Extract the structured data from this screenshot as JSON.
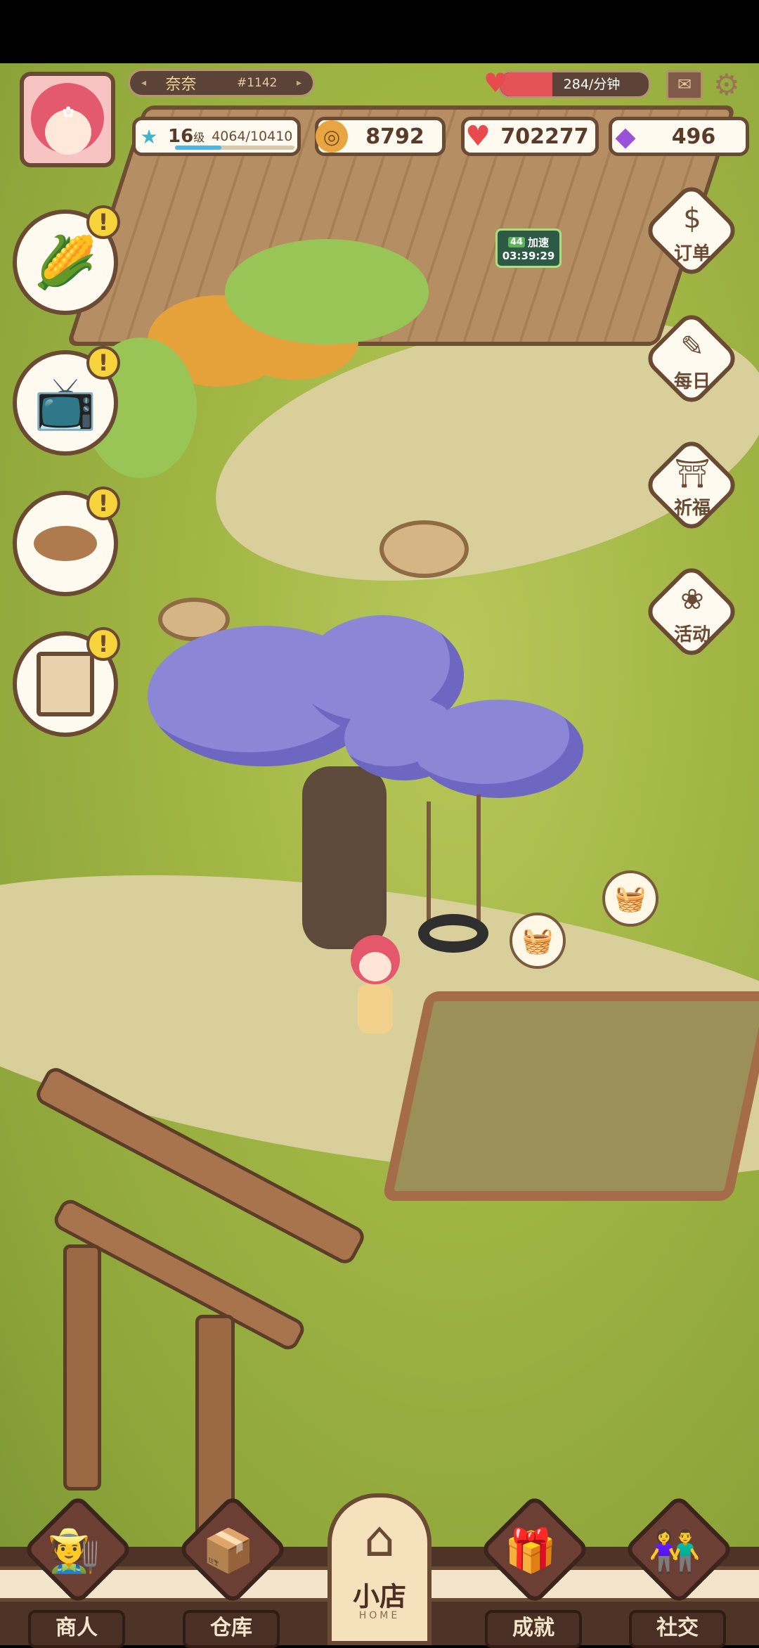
{
  "player": {
    "name": "奈奈",
    "id": "#1142",
    "level": "16",
    "level_unit": "级",
    "xp": "4064/10410",
    "xp_fraction": 0.39
  },
  "production": {
    "rate": "284/分钟"
  },
  "resources": {
    "coins": "8792",
    "hearts": "702277",
    "gems": "496"
  },
  "shop_timer": {
    "level": "44",
    "label": "加速",
    "time": "03:39:29"
  },
  "left_quests": [
    {
      "icon": "corn-icon",
      "alert": "!"
    },
    {
      "icon": "tv-ad-icon",
      "alert": "!"
    },
    {
      "icon": "flour-icon",
      "alert": "!"
    },
    {
      "icon": "shop-sign-icon",
      "alert": "!"
    }
  ],
  "right_menu": [
    {
      "label": "订单",
      "icon": "order-book-icon"
    },
    {
      "label": "每日",
      "icon": "daily-notepad-icon"
    },
    {
      "label": "祈福",
      "icon": "prayer-icon"
    },
    {
      "label": "活动",
      "icon": "event-balloon-icon"
    }
  ],
  "bottom_nav": {
    "merchant": "商人",
    "warehouse": "仓库",
    "home": "小店",
    "home_sub": "HOME",
    "achievement": "成就",
    "social": "社交"
  },
  "colors": {
    "frame_brown": "#6b4a34",
    "cream": "#fffaf0",
    "heart_red": "#e74b4d",
    "xp_blue": "#4bb6e5",
    "alert_yellow": "#f7d33c"
  }
}
